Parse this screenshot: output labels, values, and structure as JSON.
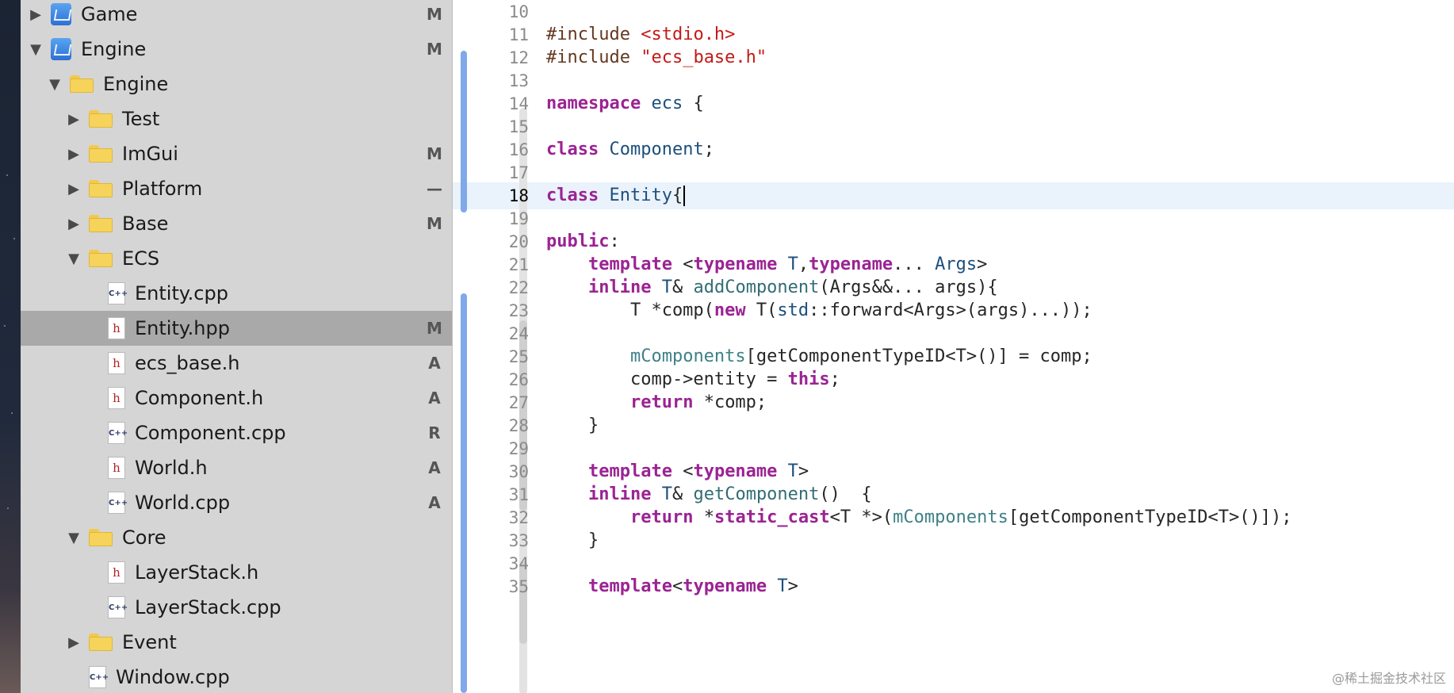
{
  "navigator": {
    "items": [
      {
        "label": "Game",
        "status": "M",
        "icon": "xcode-project-icon",
        "expanded": false,
        "depth": 0,
        "kind": "project"
      },
      {
        "label": "Engine",
        "status": "M",
        "icon": "xcode-project-icon",
        "expanded": true,
        "depth": 0,
        "kind": "project"
      },
      {
        "label": "Engine",
        "status": "",
        "icon": "folder-icon",
        "expanded": true,
        "depth": 1,
        "kind": "folder"
      },
      {
        "label": "Test",
        "status": "",
        "icon": "folder-icon",
        "expanded": false,
        "depth": 2,
        "kind": "folder"
      },
      {
        "label": "ImGui",
        "status": "M",
        "icon": "folder-icon",
        "expanded": false,
        "depth": 2,
        "kind": "folder"
      },
      {
        "label": "Platform",
        "status": "—",
        "icon": "folder-icon",
        "expanded": false,
        "depth": 2,
        "kind": "folder"
      },
      {
        "label": "Base",
        "status": "M",
        "icon": "folder-icon",
        "expanded": false,
        "depth": 2,
        "kind": "folder"
      },
      {
        "label": "ECS",
        "status": "",
        "icon": "folder-icon",
        "expanded": true,
        "depth": 2,
        "kind": "folder"
      },
      {
        "label": "Entity.cpp",
        "status": "",
        "icon": "cpp-file-icon",
        "depth": 3,
        "kind": "cpp"
      },
      {
        "label": "Entity.hpp",
        "status": "M",
        "icon": "header-file-icon",
        "depth": 3,
        "kind": "h",
        "selected": true
      },
      {
        "label": "ecs_base.h",
        "status": "A",
        "icon": "header-file-icon",
        "depth": 3,
        "kind": "h"
      },
      {
        "label": "Component.h",
        "status": "A",
        "icon": "header-file-icon",
        "depth": 3,
        "kind": "h"
      },
      {
        "label": "Component.cpp",
        "status": "R",
        "icon": "cpp-file-icon",
        "depth": 3,
        "kind": "cpp"
      },
      {
        "label": "World.h",
        "status": "A",
        "icon": "header-file-icon",
        "depth": 3,
        "kind": "h"
      },
      {
        "label": "World.cpp",
        "status": "A",
        "icon": "cpp-file-icon",
        "depth": 3,
        "kind": "cpp"
      },
      {
        "label": "Core",
        "status": "",
        "icon": "folder-icon",
        "expanded": true,
        "depth": 2,
        "kind": "folder"
      },
      {
        "label": "LayerStack.h",
        "status": "",
        "icon": "header-file-icon",
        "depth": 3,
        "kind": "h"
      },
      {
        "label": "LayerStack.cpp",
        "status": "",
        "icon": "cpp-file-icon",
        "depth": 3,
        "kind": "cpp"
      },
      {
        "label": "Event",
        "status": "",
        "icon": "folder-icon",
        "expanded": false,
        "depth": 2,
        "kind": "folder"
      },
      {
        "label": "Window.cpp",
        "status": "",
        "icon": "cpp-file-icon",
        "depth": 2,
        "kind": "cpp"
      }
    ]
  },
  "editor": {
    "current_line": 18,
    "lines": [
      {
        "n": "10",
        "tokens": []
      },
      {
        "n": "11",
        "tokens": [
          [
            "pp",
            "#include "
          ],
          [
            "str",
            "<stdio.h>"
          ]
        ]
      },
      {
        "n": "12",
        "tokens": [
          [
            "pp",
            "#include "
          ],
          [
            "str",
            "\"ecs_base.h\""
          ]
        ]
      },
      {
        "n": "13",
        "tokens": []
      },
      {
        "n": "14",
        "tokens": [
          [
            "kw",
            "namespace"
          ],
          [
            "pl",
            " "
          ],
          [
            "type",
            "ecs"
          ],
          [
            "pl",
            " {"
          ]
        ]
      },
      {
        "n": "15",
        "tokens": []
      },
      {
        "n": "16",
        "tokens": [
          [
            "kw",
            "class"
          ],
          [
            "pl",
            " "
          ],
          [
            "type",
            "Component"
          ],
          [
            "pl",
            ";"
          ]
        ]
      },
      {
        "n": "17",
        "tokens": []
      },
      {
        "n": "18",
        "tokens": [
          [
            "kw",
            "class"
          ],
          [
            "pl",
            " "
          ],
          [
            "type",
            "Entity"
          ],
          [
            "pl",
            "{"
          ]
        ],
        "caret": true
      },
      {
        "n": "19",
        "tokens": []
      },
      {
        "n": "20",
        "tokens": [
          [
            "kw",
            "public"
          ],
          [
            "pl",
            ":"
          ]
        ]
      },
      {
        "n": "21",
        "tokens": [
          [
            "pl",
            "    "
          ],
          [
            "kw",
            "template"
          ],
          [
            "pl",
            " <"
          ],
          [
            "kw",
            "typename"
          ],
          [
            "pl",
            " "
          ],
          [
            "type",
            "T"
          ],
          [
            "pl",
            ","
          ],
          [
            "kw",
            "typename"
          ],
          [
            "pl",
            "... "
          ],
          [
            "type",
            "Args"
          ],
          [
            "pl",
            ">"
          ]
        ]
      },
      {
        "n": "22",
        "tokens": [
          [
            "pl",
            "    "
          ],
          [
            "kw",
            "inline"
          ],
          [
            "pl",
            " "
          ],
          [
            "type",
            "T"
          ],
          [
            "pl",
            "& "
          ],
          [
            "fn",
            "addComponent"
          ],
          [
            "pl",
            "(Args&&... args){"
          ]
        ]
      },
      {
        "n": "23",
        "tokens": [
          [
            "pl",
            "        T *comp("
          ],
          [
            "kw",
            "new"
          ],
          [
            "pl",
            " T("
          ],
          [
            "type",
            "std"
          ],
          [
            "pl",
            "::forward<Args>(args)...));"
          ]
        ]
      },
      {
        "n": "24",
        "tokens": []
      },
      {
        "n": "25",
        "tokens": [
          [
            "pl",
            "        "
          ],
          [
            "mem",
            "mComponents"
          ],
          [
            "pl",
            "[getComponentTypeID<T>()] = comp;"
          ]
        ]
      },
      {
        "n": "26",
        "tokens": [
          [
            "pl",
            "        comp->entity = "
          ],
          [
            "kw",
            "this"
          ],
          [
            "pl",
            ";"
          ]
        ]
      },
      {
        "n": "27",
        "tokens": [
          [
            "pl",
            "        "
          ],
          [
            "kw",
            "return"
          ],
          [
            "pl",
            " *comp;"
          ]
        ]
      },
      {
        "n": "28",
        "tokens": [
          [
            "pl",
            "    }"
          ]
        ]
      },
      {
        "n": "29",
        "tokens": []
      },
      {
        "n": "30",
        "tokens": [
          [
            "pl",
            "    "
          ],
          [
            "kw",
            "template"
          ],
          [
            "pl",
            " <"
          ],
          [
            "kw",
            "typename"
          ],
          [
            "pl",
            " "
          ],
          [
            "type",
            "T"
          ],
          [
            "pl",
            ">"
          ]
        ]
      },
      {
        "n": "31",
        "tokens": [
          [
            "pl",
            "    "
          ],
          [
            "kw",
            "inline"
          ],
          [
            "pl",
            " "
          ],
          [
            "type",
            "T"
          ],
          [
            "pl",
            "& "
          ],
          [
            "fn",
            "getComponent"
          ],
          [
            "pl",
            "()  {"
          ]
        ]
      },
      {
        "n": "32",
        "tokens": [
          [
            "pl",
            "        "
          ],
          [
            "kw",
            "return"
          ],
          [
            "pl",
            " *"
          ],
          [
            "kw",
            "static_cast"
          ],
          [
            "pl",
            "<T *>("
          ],
          [
            "mem",
            "mComponents"
          ],
          [
            "pl",
            "[getComponentTypeID<T>()]);"
          ]
        ]
      },
      {
        "n": "33",
        "tokens": [
          [
            "pl",
            "    }"
          ]
        ]
      },
      {
        "n": "34",
        "tokens": []
      },
      {
        "n": "35",
        "tokens": [
          [
            "pl",
            "    "
          ],
          [
            "kw",
            "template"
          ],
          [
            "pl",
            "<"
          ],
          [
            "kw",
            "typename"
          ],
          [
            "pl",
            " "
          ],
          [
            "type",
            "T"
          ],
          [
            "pl",
            ">"
          ]
        ]
      }
    ]
  },
  "watermark": "@稀土掘金技术社区",
  "colors": {
    "keyword": "#9b2393",
    "preprocessor": "#643820",
    "string": "#c41a16",
    "type": "#1c4f7c",
    "function": "#326d74",
    "member": "#3e8087",
    "change_bar": "#7fa9e8",
    "selection": "#a9a9a9",
    "navigator_bg": "#d5d5d5"
  }
}
